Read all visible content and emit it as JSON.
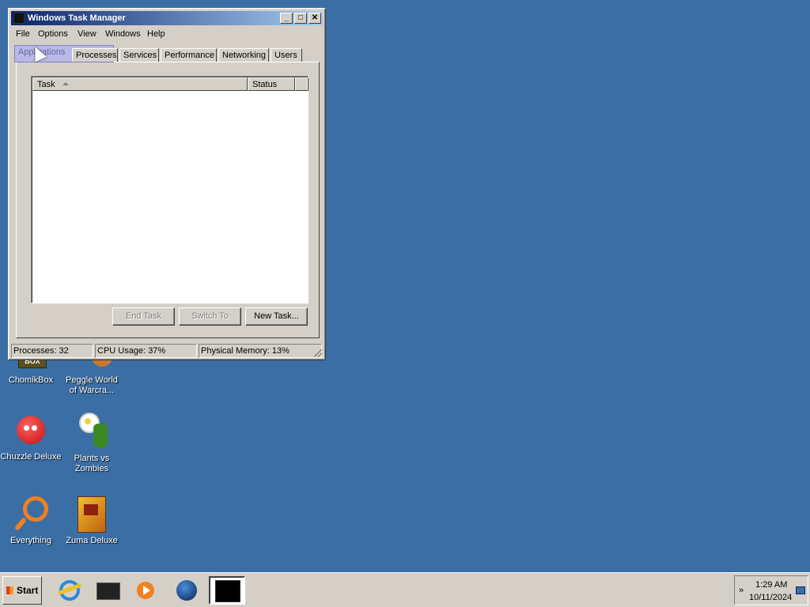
{
  "window": {
    "title": "Windows Task Manager",
    "menu": [
      "File",
      "Options",
      "View",
      "Windows",
      "Help"
    ],
    "tabs": [
      "Applications",
      "Processes",
      "Services",
      "Performance",
      "Networking",
      "Users"
    ],
    "active_tab": "Applications",
    "list_columns": [
      "Task",
      "Status"
    ],
    "buttons": {
      "end_task": "End Task",
      "switch_to": "Switch To",
      "new_task": "New Task..."
    },
    "status": {
      "processes": "Processes: 32",
      "cpu": "CPU Usage: 37%",
      "memory": "Physical Memory: 13%"
    }
  },
  "desktop_icons": [
    {
      "label": "ChomikBox",
      "icon": "chomikbox-icon"
    },
    {
      "label": "Peggle World of Warcra...",
      "icon": "peggle-icon"
    },
    {
      "label": "Chuzzle Deluxe",
      "icon": "chuzzle-icon"
    },
    {
      "label": "Plants vs Zombies",
      "icon": "plants-vs-zombies-icon"
    },
    {
      "label": "Everything",
      "icon": "everything-search-icon"
    },
    {
      "label": "Zuma Deluxe",
      "icon": "zuma-icon"
    }
  ],
  "taskbar": {
    "start_label": "Start",
    "quick_launch": [
      "internet-explorer-icon",
      "chomikbox-icon",
      "media-player-icon",
      "globe-icon",
      "task-manager-icon"
    ],
    "time": "1:29 AM",
    "date": "10/11/2024"
  },
  "colors": {
    "desktop": "#3a6ea5",
    "title_active": "#0a246a"
  }
}
